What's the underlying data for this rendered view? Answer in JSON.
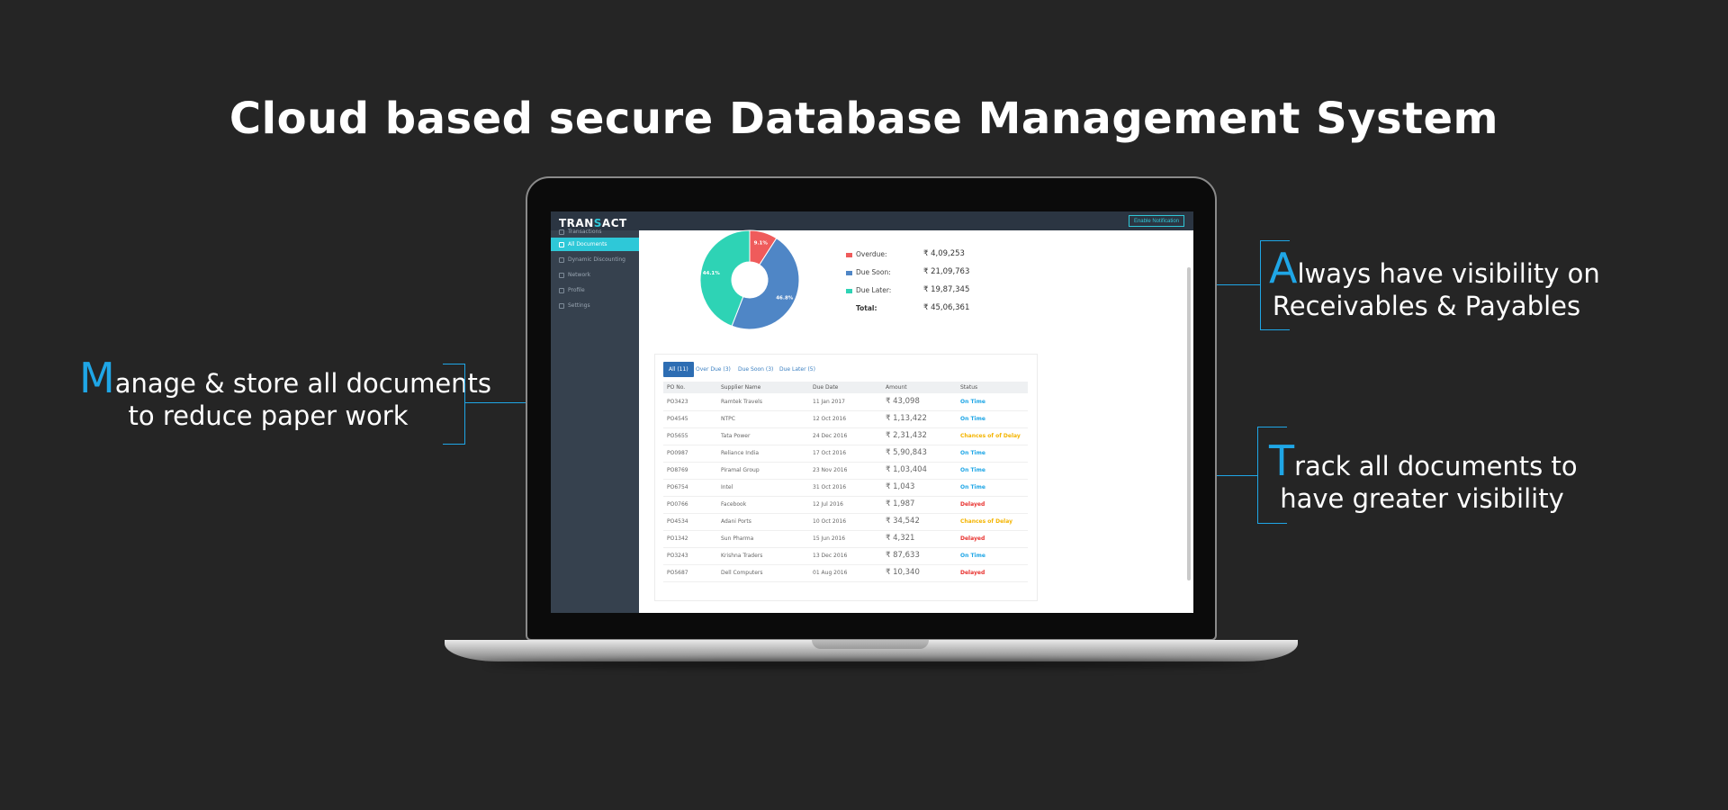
{
  "hero_title": "Cloud based secure Database Management System",
  "colors": {
    "accent": "#1fa6e6",
    "teal": "#2ec8d8",
    "overdue": "#ef5b5b",
    "due_soon": "#4f86c6",
    "due_later": "#2ed3b5",
    "on_time": "#1fa6e6",
    "delayed": "#e8322f",
    "chances_of_delay": "#f4b400"
  },
  "callouts": {
    "left": {
      "big_letter": "M",
      "line1_rest": "anage & store all documents",
      "line2": "to reduce paper work"
    },
    "right_top": {
      "big_letter": "A",
      "line1_rest": "lways have visibility on",
      "line2": "Receivables & Payables"
    },
    "right_bottom": {
      "big_letter": "T",
      "line1_rest": "rack all documents to",
      "line2": "have greater visibility"
    }
  },
  "app": {
    "logo_pre": "TRAN",
    "logo_mid": "S",
    "logo_post": "ACT",
    "notify_label": "Enable Notification",
    "sidebar": [
      {
        "label": "Transactions",
        "icon": "transactions-icon"
      },
      {
        "label": "All Documents",
        "icon": "documents-icon",
        "active": true
      },
      {
        "label": "Dynamic Discounting",
        "icon": "discount-icon"
      },
      {
        "label": "Network",
        "icon": "network-icon"
      },
      {
        "label": "Profile",
        "icon": "profile-icon"
      },
      {
        "label": "Settings",
        "icon": "settings-icon"
      }
    ],
    "legend": {
      "overdue_label": "Overdue:",
      "overdue_value": "₹ 4,09,253",
      "due_soon_label": "Due Soon:",
      "due_soon_value": "₹ 21,09,763",
      "due_later_label": "Due Later:",
      "due_later_value": "₹ 19,87,345",
      "total_label": "Total:",
      "total_value": "₹ 45,06,361"
    },
    "tabs": [
      "All (11)",
      "Over Due (3)",
      "Due Soon (3)",
      "Due Later (5)"
    ],
    "table_headers": [
      "PO No.",
      "Supplier Name",
      "Due Date",
      "Amount",
      "Status"
    ],
    "rows": [
      {
        "po": "PO3423",
        "supplier": "Ramtek Travels",
        "due": "11 Jan 2017",
        "amount": "₹ 43,098",
        "status": "On Time",
        "kind": "on_time"
      },
      {
        "po": "PO4545",
        "supplier": "NTPC",
        "due": "12 Oct 2016",
        "amount": "₹ 1,13,422",
        "status": "On Time",
        "kind": "on_time"
      },
      {
        "po": "PO5655",
        "supplier": "Tata Power",
        "due": "24 Dec 2016",
        "amount": "₹ 2,31,432",
        "status": "Chances of of Delay",
        "kind": "chances_of_delay"
      },
      {
        "po": "PO0987",
        "supplier": "Reliance India",
        "due": "17 Oct 2016",
        "amount": "₹ 5,90,843",
        "status": "On Time",
        "kind": "on_time"
      },
      {
        "po": "PO8769",
        "supplier": "Piramal Group",
        "due": "23 Nov 2016",
        "amount": "₹ 1,03,404",
        "status": "On Time",
        "kind": "on_time"
      },
      {
        "po": "PO6754",
        "supplier": "Intel",
        "due": "31 Oct 2016",
        "amount": "₹ 1,043",
        "status": "On Time",
        "kind": "on_time"
      },
      {
        "po": "PO0766",
        "supplier": "Facebook",
        "due": "12 Jul 2016",
        "amount": "₹ 1,987",
        "status": "Delayed",
        "kind": "delayed"
      },
      {
        "po": "PO4534",
        "supplier": "Adani Ports",
        "due": "10 Oct 2016",
        "amount": "₹ 34,542",
        "status": "Chances of Delay",
        "kind": "chances_of_delay"
      },
      {
        "po": "PO1342",
        "supplier": "Sun Pharma",
        "due": "15 Jun 2016",
        "amount": "₹ 4,321",
        "status": "Delayed",
        "kind": "delayed"
      },
      {
        "po": "PO3243",
        "supplier": "Krishna Traders",
        "due": "13 Dec 2016",
        "amount": "₹ 87,633",
        "status": "On Time",
        "kind": "on_time"
      },
      {
        "po": "PO5687",
        "supplier": "Dell Computers",
        "due": "01 Aug 2016",
        "amount": "₹ 10,340",
        "status": "Delayed",
        "kind": "delayed"
      }
    ]
  },
  "chart_data": {
    "type": "pie",
    "categories": [
      "Overdue",
      "Due Soon",
      "Due Later"
    ],
    "values": [
      9.1,
      46.8,
      44.1
    ],
    "labels": [
      "9.1%",
      "46.8%",
      "44.1%"
    ]
  }
}
